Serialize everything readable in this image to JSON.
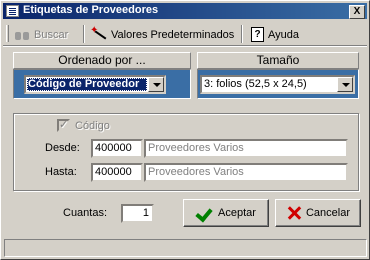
{
  "window": {
    "title": "Etiquetas de Proveedores",
    "close_label": "X"
  },
  "toolbar": {
    "buscar_label": "Buscar",
    "valores_label": "Valores Predeterminados",
    "ayuda_label": "Ayuda"
  },
  "ordenado": {
    "header": "Ordenado por ...",
    "selected": "Código de Proveedor"
  },
  "tamano": {
    "header": "Tamaño",
    "selected": "3: folios (52,5 x 24,5)"
  },
  "filter": {
    "checkbox_label": "Código",
    "checked": true,
    "desde_label": "Desde:",
    "desde_value": "400000",
    "desde_name": "Proveedores Varios",
    "hasta_label": "Hasta:",
    "hasta_value": "400000",
    "hasta_name": "Proveedores Varios"
  },
  "cuantas": {
    "label": "Cuantas:",
    "value": "1"
  },
  "actions": {
    "accept_label": "Aceptar",
    "cancel_label": "Cancelar"
  },
  "colors": {
    "title_bar": "#0a246a",
    "panel_blue": "#3a6ea5",
    "face": "#d4d0c8"
  },
  "icons": {
    "search": "binoculars-icon",
    "defaults": "magic-wand-icon",
    "help": "help-book-icon",
    "accept": "green-check-icon",
    "cancel": "red-x-icon"
  }
}
